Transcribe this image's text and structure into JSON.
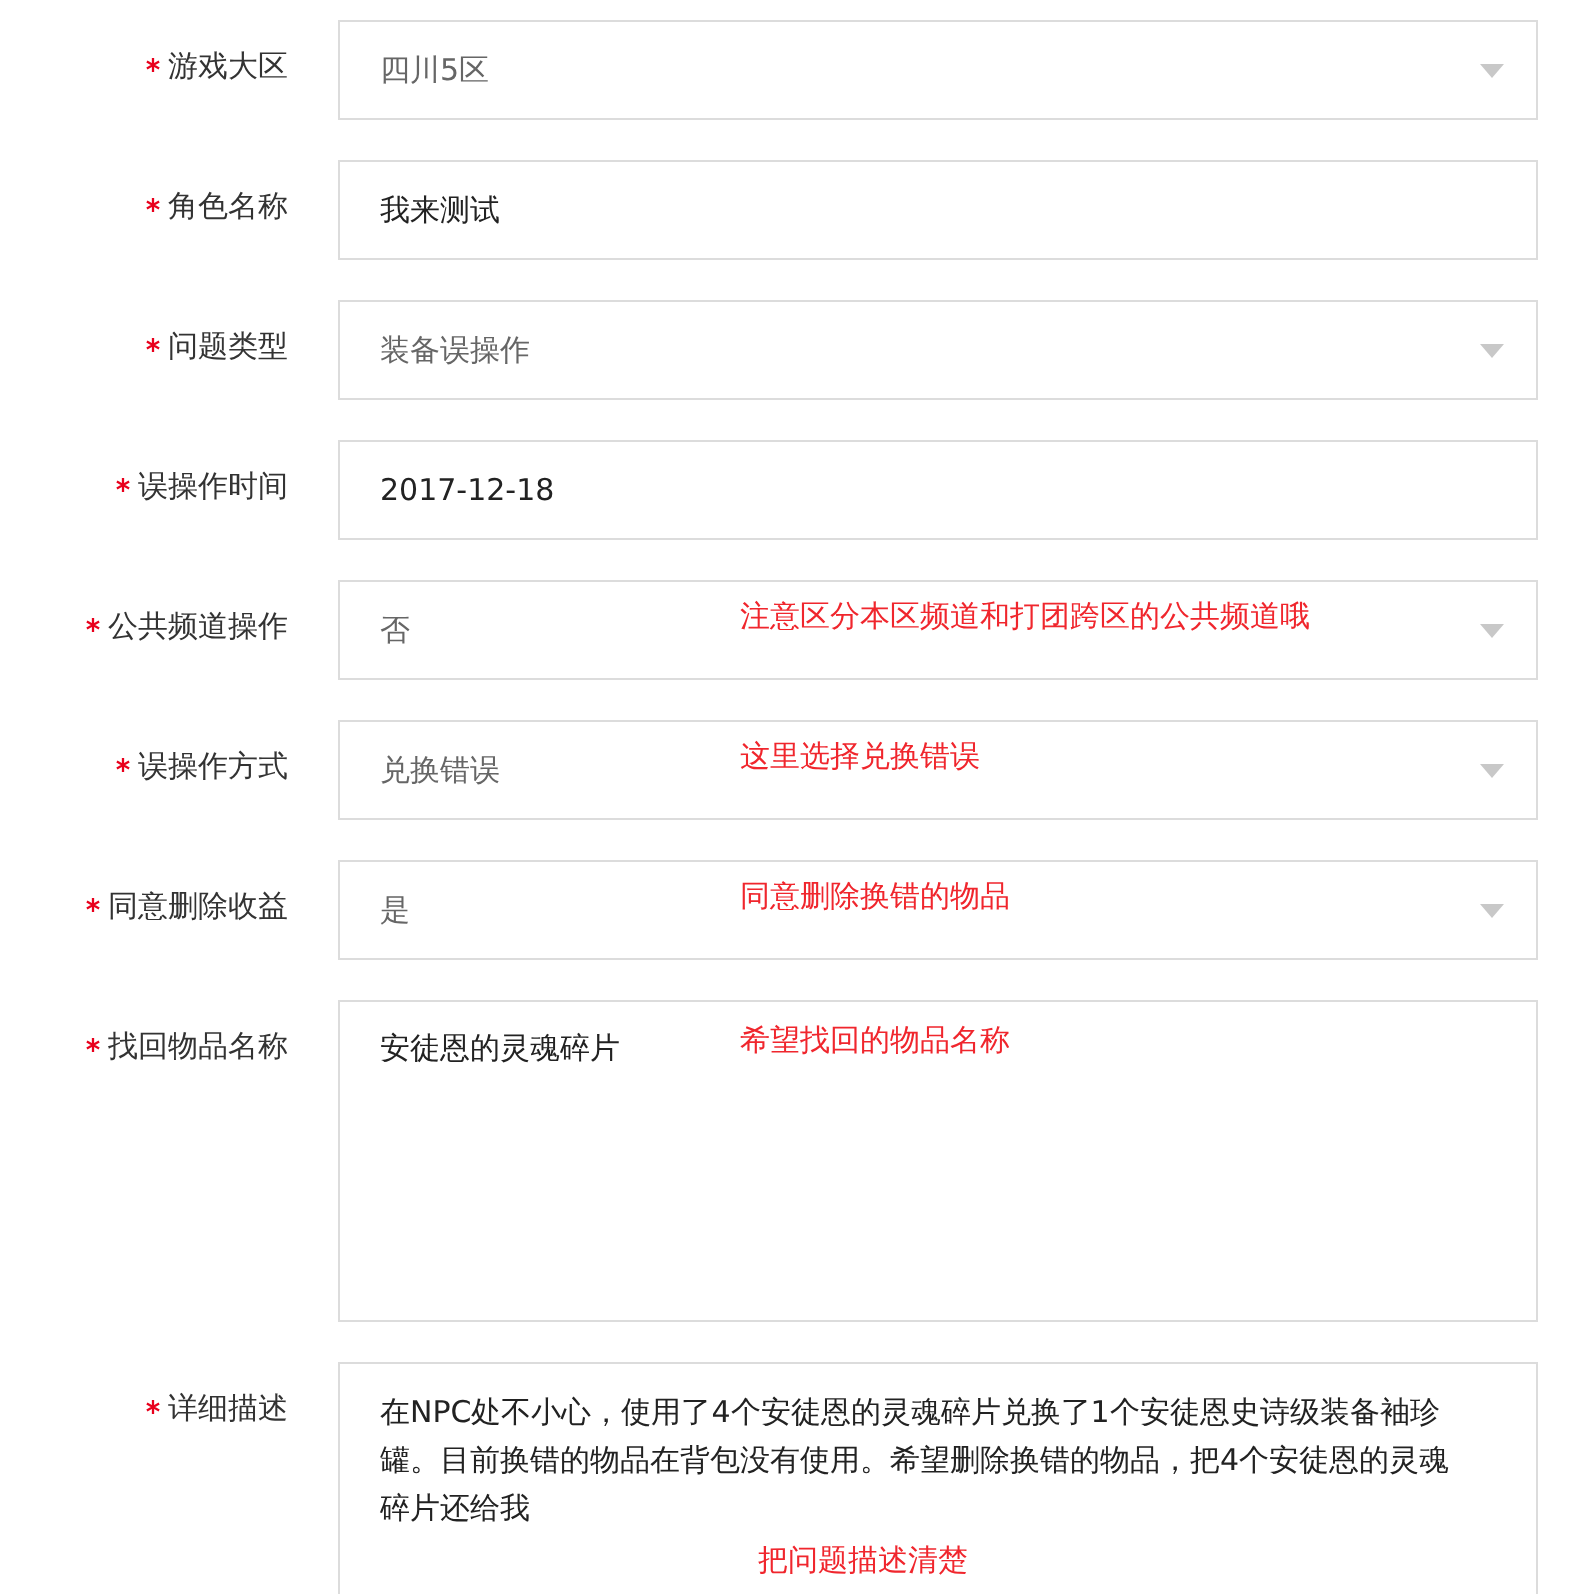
{
  "fields": [
    {
      "label": "游戏大区",
      "required": true,
      "kind": "select",
      "value": "四川5区"
    },
    {
      "label": "角色名称",
      "required": true,
      "kind": "input",
      "value": "我来测试"
    },
    {
      "label": "问题类型",
      "required": true,
      "kind": "select",
      "value": "装备误操作"
    },
    {
      "label": "误操作时间",
      "required": true,
      "kind": "input",
      "value": "2017-12-18"
    },
    {
      "label": "公共频道操作",
      "required": true,
      "kind": "select",
      "value": "否",
      "note": "注意区分本区频道和打团跨区的公共频道哦"
    },
    {
      "label": "误操作方式",
      "required": true,
      "kind": "select",
      "value": "兑换错误",
      "note": "这里选择兑换错误"
    },
    {
      "label": "同意删除收益",
      "required": true,
      "kind": "select",
      "value": "是",
      "note": "同意删除换错的物品"
    },
    {
      "label": "找回物品名称",
      "required": true,
      "kind": "textarea",
      "value": "安徒恩的灵魂碎片",
      "note": "希望找回的物品名称"
    },
    {
      "label": "详细描述",
      "required": true,
      "kind": "textarea-long",
      "value": "在NPC处不小心，使用了4个安徒恩的灵魂碎片兑换了1个安徒恩史诗级装备袖珍罐。目前换错的物品在背包没有使用。希望删除换错的物品，把4个安徒恩的灵魂碎片还给我",
      "note": "把问题描述清楚"
    }
  ]
}
